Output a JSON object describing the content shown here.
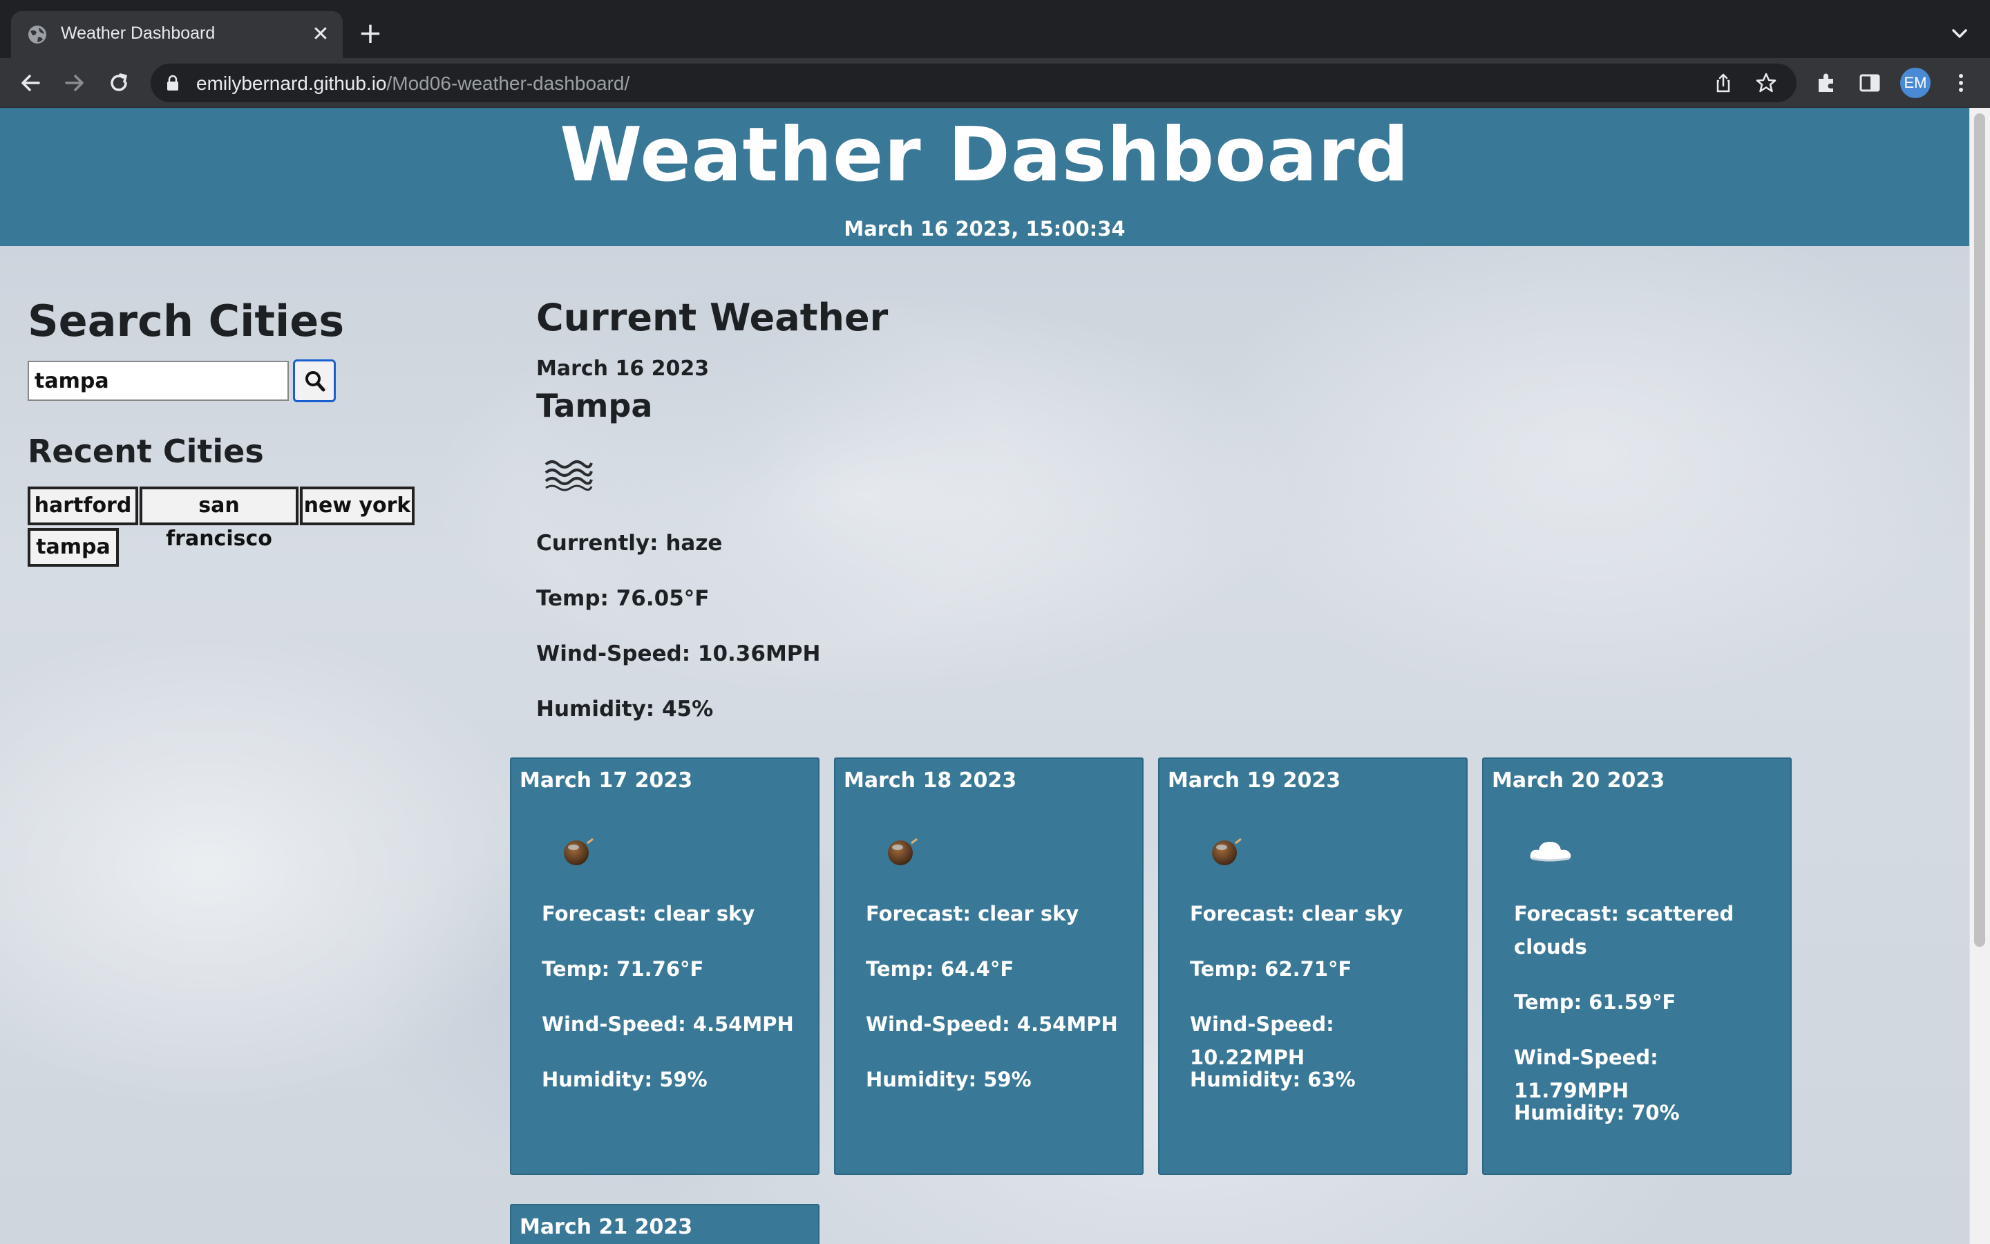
{
  "browser": {
    "tab_title": "Weather Dashboard",
    "url_host": "emilybernard.github.io",
    "url_path": "/Mod06-weather-dashboard/",
    "profile_initials": "EM"
  },
  "header": {
    "title": "Weather Dashboard",
    "datetime": "March 16 2023, 15:00:34"
  },
  "search": {
    "heading": "Search Cities",
    "input_value": "tampa",
    "button_icon": "search-icon"
  },
  "recent": {
    "heading": "Recent Cities",
    "cities": [
      "hartford",
      "san francisco",
      "new york",
      "tampa"
    ]
  },
  "current": {
    "heading": "Current Weather",
    "date": "March 16 2023",
    "city": "Tampa",
    "icon": "haze-icon",
    "currently": "Currently: haze",
    "temp": "Temp: 76.05°F",
    "wind": "Wind-Speed: 10.36MPH",
    "humidity": "Humidity: 45%"
  },
  "forecast": [
    {
      "date": "March 17 2023",
      "icon": "clear-sky-icon",
      "forecast": "Forecast: clear sky",
      "temp": "Temp: 71.76°F",
      "wind": "Wind-Speed: 4.54MPH",
      "humidity": "Humidity: 59%"
    },
    {
      "date": "March 18 2023",
      "icon": "clear-sky-icon",
      "forecast": "Forecast: clear sky",
      "temp": "Temp: 64.4°F",
      "wind": "Wind-Speed: 4.54MPH",
      "humidity": "Humidity: 59%"
    },
    {
      "date": "March 19 2023",
      "icon": "clear-sky-icon",
      "forecast": "Forecast: clear sky",
      "temp": "Temp: 62.71°F",
      "wind": "Wind-Speed: 10.22MPH",
      "humidity": "Humidity: 63%"
    },
    {
      "date": "March 20 2023",
      "icon": "scattered-clouds-icon",
      "forecast": "Forecast: scattered clouds",
      "temp": "Temp: 61.59°F",
      "wind": "Wind-Speed: 11.79MPH",
      "humidity": "Humidity: 70%"
    },
    {
      "date": "March 21 2023"
    }
  ],
  "colors": {
    "header_bg": "#397896",
    "card_bg": "#397896",
    "chrome_bg": "#202124",
    "toolbar_bg": "#35363a"
  }
}
